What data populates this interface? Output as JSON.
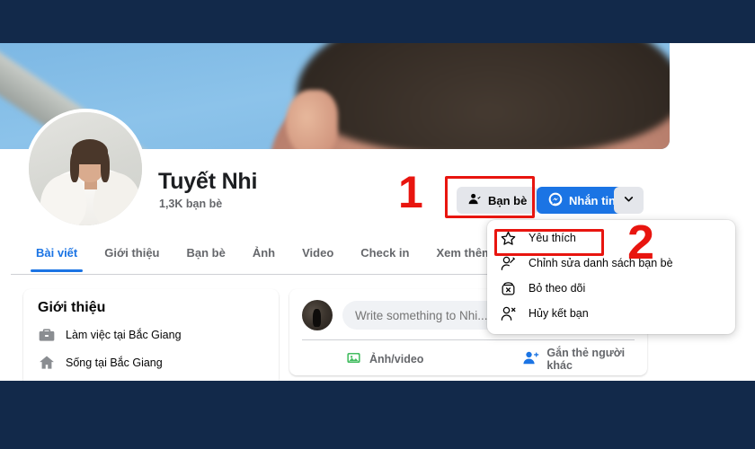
{
  "profile": {
    "name": "Tuyết Nhi",
    "friend_count": "1,3K bạn bè",
    "avatar_name": "profile-photo",
    "cover_name": "cover-photo"
  },
  "actions": {
    "friends_label": "Bạn bè",
    "friends_icon": "user-check-icon",
    "message_label": "Nhắn tin",
    "message_icon": "messenger-icon",
    "more_icon": "chevron-down-icon"
  },
  "tabs": [
    {
      "label": "Bài viết",
      "active": true
    },
    {
      "label": "Giới thiệu",
      "active": false
    },
    {
      "label": "Bạn bè",
      "active": false
    },
    {
      "label": "Ảnh",
      "active": false
    },
    {
      "label": "Video",
      "active": false
    },
    {
      "label": "Check in",
      "active": false
    },
    {
      "label": "Xem thêm",
      "active": false,
      "has_caret": true
    }
  ],
  "intro": {
    "title": "Giới thiệu",
    "rows": [
      {
        "icon": "briefcase-icon",
        "text": "Làm việc tại Bắc Giang"
      },
      {
        "icon": "home-icon",
        "text": "Sống tại Bắc Giang"
      }
    ]
  },
  "composer": {
    "placeholder": "Write something to Nhi...",
    "value": "",
    "photo_label": "Ảnh/video",
    "photo_icon": "photo-video-icon",
    "tag_label": "Gắn thẻ người khác",
    "tag_icon": "tag-person-icon"
  },
  "menu": {
    "items": [
      {
        "icon": "star-icon",
        "label": "Yêu thích"
      },
      {
        "icon": "edit-friend-list-icon",
        "label": "Chỉnh sửa danh sách bạn bè"
      },
      {
        "icon": "unfollow-icon",
        "label": "Bỏ theo dõi"
      },
      {
        "icon": "unfriend-icon",
        "label": "Hủy kết bạn"
      }
    ]
  },
  "annotations": {
    "step1": "1",
    "step2": "2",
    "color": "#e8150f"
  },
  "colors": {
    "accent_blue": "#1b74e4",
    "chrome_dark": "#12294a",
    "grey_button": "#e4e6eb",
    "text_secondary": "#65676b",
    "green": "#45bd62"
  }
}
